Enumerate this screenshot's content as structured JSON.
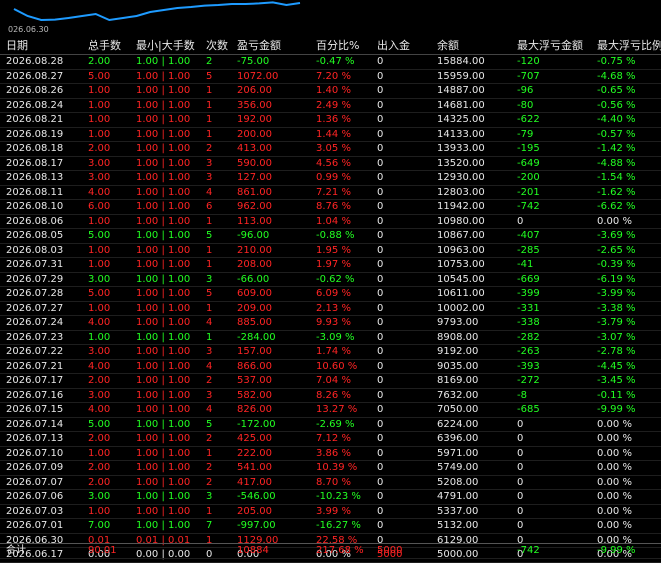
{
  "chart": {
    "x_label": "026.06.30",
    "line_color": "#1e9bff",
    "points": [
      0.65,
      0.3,
      0.1,
      0.12,
      0.2,
      0.3,
      0.4,
      0.1,
      0.2,
      0.3,
      0.5,
      0.6,
      0.7,
      0.75,
      0.82,
      0.85,
      0.9,
      0.9,
      0.93,
      0.98,
      0.85,
      0.95
    ]
  },
  "columns": [
    "日期",
    "总手数",
    "最小|大手数",
    "次数",
    "盈亏金额",
    "百分比%",
    "出入金",
    "余额",
    "最大浮亏金额",
    "最大浮亏比例"
  ],
  "rows": [
    {
      "date": "2026.08.28",
      "lots": "2.00",
      "minmax": "1.00 | 1.00",
      "count": "2",
      "pnl": "-75.00",
      "pct": "-0.47 %",
      "flow": "0",
      "balance": "15884.00",
      "maxdd": "-120",
      "maxddpct": "-0.75 %",
      "sign": "green"
    },
    {
      "date": "2026.08.27",
      "lots": "5.00",
      "minmax": "1.00 | 1.00",
      "count": "5",
      "pnl": "1072.00",
      "pct": "7.20 %",
      "flow": "0",
      "balance": "15959.00",
      "maxdd": "-707",
      "maxddpct": "-4.68 %",
      "sign": "red"
    },
    {
      "date": "2026.08.26",
      "lots": "1.00",
      "minmax": "1.00 | 1.00",
      "count": "1",
      "pnl": "206.00",
      "pct": "1.40 %",
      "flow": "0",
      "balance": "14887.00",
      "maxdd": "-96",
      "maxddpct": "-0.65 %",
      "sign": "red"
    },
    {
      "date": "2026.08.24",
      "lots": "1.00",
      "minmax": "1.00 | 1.00",
      "count": "1",
      "pnl": "356.00",
      "pct": "2.49 %",
      "flow": "0",
      "balance": "14681.00",
      "maxdd": "-80",
      "maxddpct": "-0.56 %",
      "sign": "red"
    },
    {
      "date": "2026.08.21",
      "lots": "1.00",
      "minmax": "1.00 | 1.00",
      "count": "1",
      "pnl": "192.00",
      "pct": "1.36 %",
      "flow": "0",
      "balance": "14325.00",
      "maxdd": "-622",
      "maxddpct": "-4.40 %",
      "sign": "red"
    },
    {
      "date": "2026.08.19",
      "lots": "1.00",
      "minmax": "1.00 | 1.00",
      "count": "1",
      "pnl": "200.00",
      "pct": "1.44 %",
      "flow": "0",
      "balance": "14133.00",
      "maxdd": "-79",
      "maxddpct": "-0.57 %",
      "sign": "red"
    },
    {
      "date": "2026.08.18",
      "lots": "2.00",
      "minmax": "1.00 | 1.00",
      "count": "2",
      "pnl": "413.00",
      "pct": "3.05 %",
      "flow": "0",
      "balance": "13933.00",
      "maxdd": "-195",
      "maxddpct": "-1.42 %",
      "sign": "red"
    },
    {
      "date": "2026.08.17",
      "lots": "3.00",
      "minmax": "1.00 | 1.00",
      "count": "3",
      "pnl": "590.00",
      "pct": "4.56 %",
      "flow": "0",
      "balance": "13520.00",
      "maxdd": "-649",
      "maxddpct": "-4.88 %",
      "sign": "red"
    },
    {
      "date": "2026.08.13",
      "lots": "3.00",
      "minmax": "1.00 | 1.00",
      "count": "3",
      "pnl": "127.00",
      "pct": "0.99 %",
      "flow": "0",
      "balance": "12930.00",
      "maxdd": "-200",
      "maxddpct": "-1.54 %",
      "sign": "red"
    },
    {
      "date": "2026.08.11",
      "lots": "4.00",
      "minmax": "1.00 | 1.00",
      "count": "4",
      "pnl": "861.00",
      "pct": "7.21 %",
      "flow": "0",
      "balance": "12803.00",
      "maxdd": "-201",
      "maxddpct": "-1.62 %",
      "sign": "red"
    },
    {
      "date": "2026.08.10",
      "lots": "6.00",
      "minmax": "1.00 | 1.00",
      "count": "6",
      "pnl": "962.00",
      "pct": "8.76 %",
      "flow": "0",
      "balance": "11942.00",
      "maxdd": "-742",
      "maxddpct": "-6.62 %",
      "sign": "red"
    },
    {
      "date": "2026.08.06",
      "lots": "1.00",
      "minmax": "1.00 | 1.00",
      "count": "1",
      "pnl": "113.00",
      "pct": "1.04 %",
      "flow": "0",
      "balance": "10980.00",
      "maxdd": "0",
      "maxddpct": "0.00 %",
      "sign": "red"
    },
    {
      "date": "2026.08.05",
      "lots": "5.00",
      "minmax": "1.00 | 1.00",
      "count": "5",
      "pnl": "-96.00",
      "pct": "-0.88 %",
      "flow": "0",
      "balance": "10867.00",
      "maxdd": "-407",
      "maxddpct": "-3.69 %",
      "sign": "green"
    },
    {
      "date": "2026.08.03",
      "lots": "1.00",
      "minmax": "1.00 | 1.00",
      "count": "1",
      "pnl": "210.00",
      "pct": "1.95 %",
      "flow": "0",
      "balance": "10963.00",
      "maxdd": "-285",
      "maxddpct": "-2.65 %",
      "sign": "red"
    },
    {
      "date": "2026.07.31",
      "lots": "1.00",
      "minmax": "1.00 | 1.00",
      "count": "1",
      "pnl": "208.00",
      "pct": "1.97 %",
      "flow": "0",
      "balance": "10753.00",
      "maxdd": "-41",
      "maxddpct": "-0.39 %",
      "sign": "red"
    },
    {
      "date": "2026.07.29",
      "lots": "3.00",
      "minmax": "1.00 | 1.00",
      "count": "3",
      "pnl": "-66.00",
      "pct": "-0.62 %",
      "flow": "0",
      "balance": "10545.00",
      "maxdd": "-669",
      "maxddpct": "-6.19 %",
      "sign": "green"
    },
    {
      "date": "2026.07.28",
      "lots": "5.00",
      "minmax": "1.00 | 1.00",
      "count": "5",
      "pnl": "609.00",
      "pct": "6.09 %",
      "flow": "0",
      "balance": "10611.00",
      "maxdd": "-399",
      "maxddpct": "-3.99 %",
      "sign": "red"
    },
    {
      "date": "2026.07.27",
      "lots": "1.00",
      "minmax": "1.00 | 1.00",
      "count": "1",
      "pnl": "209.00",
      "pct": "2.13 %",
      "flow": "0",
      "balance": "10002.00",
      "maxdd": "-331",
      "maxddpct": "-3.38 %",
      "sign": "red"
    },
    {
      "date": "2026.07.24",
      "lots": "4.00",
      "minmax": "1.00 | 1.00",
      "count": "4",
      "pnl": "885.00",
      "pct": "9.93 %",
      "flow": "0",
      "balance": "9793.00",
      "maxdd": "-338",
      "maxddpct": "-3.79 %",
      "sign": "red"
    },
    {
      "date": "2026.07.23",
      "lots": "1.00",
      "minmax": "1.00 | 1.00",
      "count": "1",
      "pnl": "-284.00",
      "pct": "-3.09 %",
      "flow": "0",
      "balance": "8908.00",
      "maxdd": "-282",
      "maxddpct": "-3.07 %",
      "sign": "green"
    },
    {
      "date": "2026.07.22",
      "lots": "3.00",
      "minmax": "1.00 | 1.00",
      "count": "3",
      "pnl": "157.00",
      "pct": "1.74 %",
      "flow": "0",
      "balance": "9192.00",
      "maxdd": "-263",
      "maxddpct": "-2.78 %",
      "sign": "red"
    },
    {
      "date": "2026.07.21",
      "lots": "4.00",
      "minmax": "1.00 | 1.00",
      "count": "4",
      "pnl": "866.00",
      "pct": "10.60 %",
      "flow": "0",
      "balance": "9035.00",
      "maxdd": "-393",
      "maxddpct": "-4.45 %",
      "sign": "red"
    },
    {
      "date": "2026.07.17",
      "lots": "2.00",
      "minmax": "1.00 | 1.00",
      "count": "2",
      "pnl": "537.00",
      "pct": "7.04 %",
      "flow": "0",
      "balance": "8169.00",
      "maxdd": "-272",
      "maxddpct": "-3.45 %",
      "sign": "red"
    },
    {
      "date": "2026.07.16",
      "lots": "3.00",
      "minmax": "1.00 | 1.00",
      "count": "3",
      "pnl": "582.00",
      "pct": "8.26 %",
      "flow": "0",
      "balance": "7632.00",
      "maxdd": "-8",
      "maxddpct": "-0.11 %",
      "sign": "red"
    },
    {
      "date": "2026.07.15",
      "lots": "4.00",
      "minmax": "1.00 | 1.00",
      "count": "4",
      "pnl": "826.00",
      "pct": "13.27 %",
      "flow": "0",
      "balance": "7050.00",
      "maxdd": "-685",
      "maxddpct": "-9.99 %",
      "sign": "red"
    },
    {
      "date": "2026.07.14",
      "lots": "5.00",
      "minmax": "1.00 | 1.00",
      "count": "5",
      "pnl": "-172.00",
      "pct": "-2.69 %",
      "flow": "0",
      "balance": "6224.00",
      "maxdd": "0",
      "maxddpct": "0.00 %",
      "sign": "green"
    },
    {
      "date": "2026.07.13",
      "lots": "2.00",
      "minmax": "1.00 | 1.00",
      "count": "2",
      "pnl": "425.00",
      "pct": "7.12 %",
      "flow": "0",
      "balance": "6396.00",
      "maxdd": "0",
      "maxddpct": "0.00 %",
      "sign": "red"
    },
    {
      "date": "2026.07.10",
      "lots": "1.00",
      "minmax": "1.00 | 1.00",
      "count": "1",
      "pnl": "222.00",
      "pct": "3.86 %",
      "flow": "0",
      "balance": "5971.00",
      "maxdd": "0",
      "maxddpct": "0.00 %",
      "sign": "red"
    },
    {
      "date": "2026.07.09",
      "lots": "2.00",
      "minmax": "1.00 | 1.00",
      "count": "2",
      "pnl": "541.00",
      "pct": "10.39 %",
      "flow": "0",
      "balance": "5749.00",
      "maxdd": "0",
      "maxddpct": "0.00 %",
      "sign": "red"
    },
    {
      "date": "2026.07.07",
      "lots": "2.00",
      "minmax": "1.00 | 1.00",
      "count": "2",
      "pnl": "417.00",
      "pct": "8.70 %",
      "flow": "0",
      "balance": "5208.00",
      "maxdd": "0",
      "maxddpct": "0.00 %",
      "sign": "red"
    },
    {
      "date": "2026.07.06",
      "lots": "3.00",
      "minmax": "1.00 | 1.00",
      "count": "3",
      "pnl": "-546.00",
      "pct": "-10.23 %",
      "flow": "0",
      "balance": "4791.00",
      "maxdd": "0",
      "maxddpct": "0.00 %",
      "sign": "green"
    },
    {
      "date": "2026.07.03",
      "lots": "1.00",
      "minmax": "1.00 | 1.00",
      "count": "1",
      "pnl": "205.00",
      "pct": "3.99 %",
      "flow": "0",
      "balance": "5337.00",
      "maxdd": "0",
      "maxddpct": "0.00 %",
      "sign": "red"
    },
    {
      "date": "2026.07.01",
      "lots": "7.00",
      "minmax": "1.00 | 1.00",
      "count": "7",
      "pnl": "-997.00",
      "pct": "-16.27 %",
      "flow": "0",
      "balance": "5132.00",
      "maxdd": "0",
      "maxddpct": "0.00 %",
      "sign": "green"
    },
    {
      "date": "2026.06.30",
      "lots": "0.01",
      "minmax": "0.01 | 0.01",
      "count": "1",
      "pnl": "1129.00",
      "pct": "22.58 %",
      "flow": "0",
      "balance": "6129.00",
      "maxdd": "0",
      "maxddpct": "0.00 %",
      "sign": "red"
    },
    {
      "date": "2026.06.17",
      "lots": "0.00",
      "minmax": "0.00 | 0.00",
      "count": "0",
      "pnl": "0.00",
      "pct": "0.00 %",
      "flow": "5000",
      "balance": "5000.00",
      "maxdd": "0",
      "maxddpct": "0.00 %",
      "sign": "white"
    }
  ],
  "total": {
    "label": "合计",
    "lots": "90.01",
    "pnl": "10884",
    "pct": "217.68 %",
    "flow": "5000",
    "maxdd": "-742",
    "maxddpct": "-9.99 %"
  },
  "colors": {
    "positive": "#ff2424",
    "negative": "#22ff22",
    "neutral": "#e8e8e8",
    "flow": "#ff2424"
  }
}
